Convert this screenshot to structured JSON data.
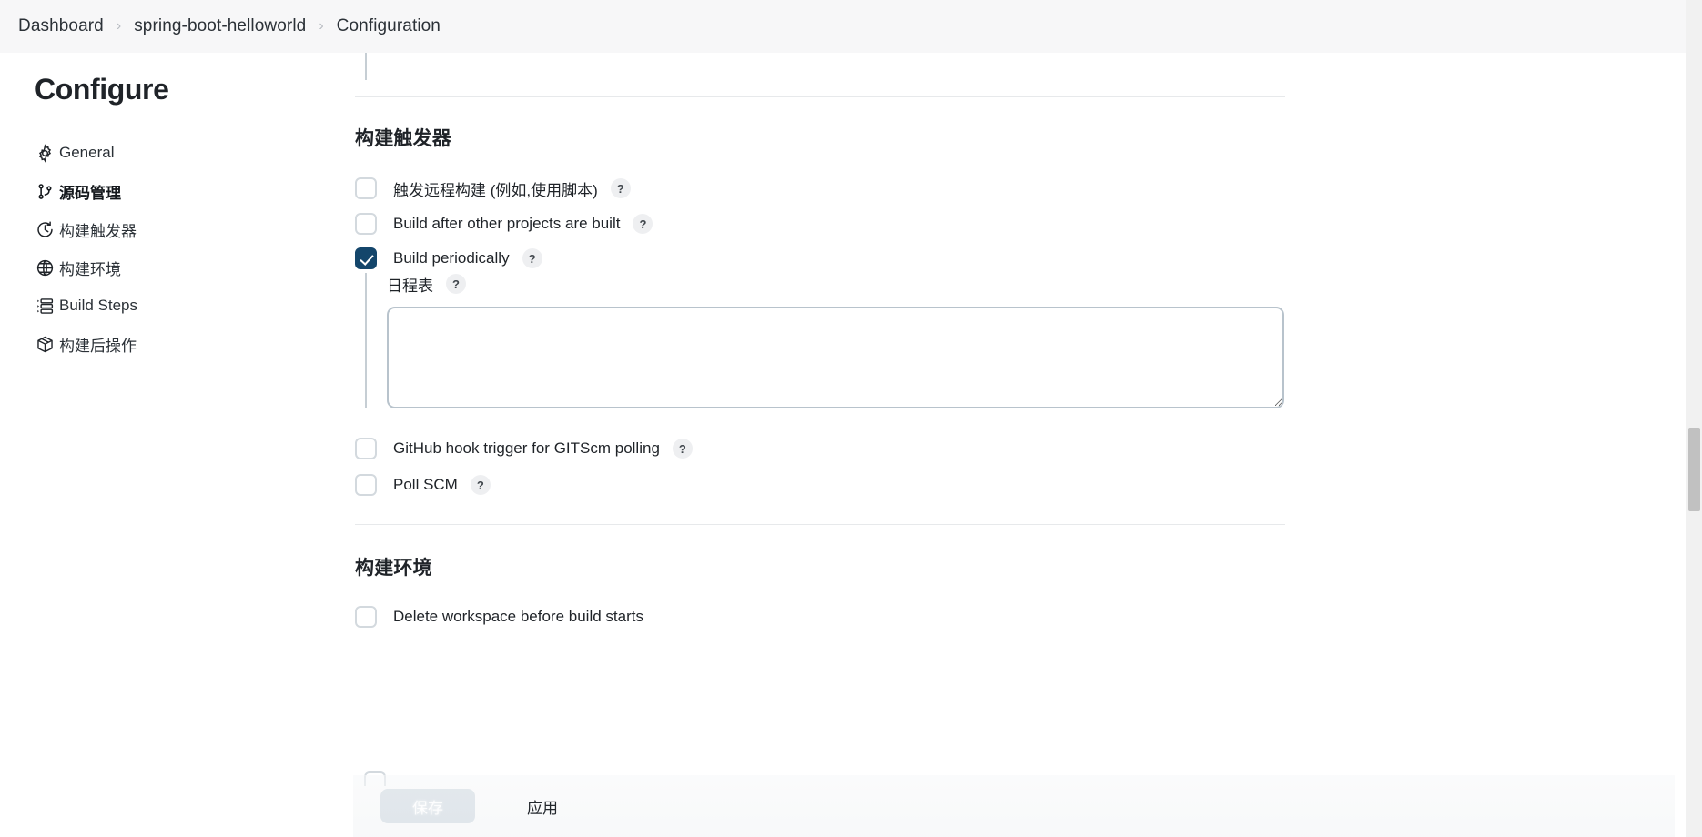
{
  "breadcrumb": {
    "items": [
      {
        "label": "Dashboard"
      },
      {
        "label": "spring-boot-helloworld"
      },
      {
        "label": "Configuration"
      }
    ],
    "separator": "›"
  },
  "sidebar": {
    "title": "Configure",
    "items": [
      {
        "label": "General",
        "icon": "gear-icon",
        "active": false
      },
      {
        "label": "源码管理",
        "icon": "git-branch-icon",
        "active": true
      },
      {
        "label": "构建触发器",
        "icon": "clock-icon",
        "active": false
      },
      {
        "label": "构建环境",
        "icon": "globe-icon",
        "active": false
      },
      {
        "label": "Build Steps",
        "icon": "list-steps-icon",
        "active": false
      },
      {
        "label": "构建后操作",
        "icon": "package-icon",
        "active": false
      }
    ]
  },
  "main": {
    "sections": {
      "triggers": {
        "title": "构建触发器",
        "checkboxes": {
          "remote": {
            "label": "触发远程构建 (例如,使用脚本)",
            "checked": false,
            "help": "?"
          },
          "after": {
            "label": "Build after other projects are built",
            "checked": false,
            "help": "?"
          },
          "periodically": {
            "label": "Build periodically",
            "checked": true,
            "help": "?"
          },
          "github": {
            "label": "GitHub hook trigger for GITScm polling",
            "checked": false,
            "help": "?"
          },
          "pollscm": {
            "label": "Poll SCM",
            "checked": false,
            "help": "?"
          }
        },
        "schedule": {
          "label": "日程表",
          "help": "?",
          "value": "",
          "placeholder": ""
        }
      },
      "environment": {
        "title": "构建环境",
        "checkboxes": {
          "delete_workspace": {
            "label": "Delete workspace before build starts",
            "checked": false
          }
        }
      }
    }
  },
  "footer": {
    "save_label": "保存",
    "apply_label": "应用"
  },
  "colors": {
    "accent": "#14466b",
    "breadcrumb_bg": "#f7f7f8",
    "border": "#e7e9eb",
    "input_border": "#b8c3cc",
    "checkbox_border": "#d3d9de",
    "indent_line": "#c6ced4",
    "scrollbar_thumb": "#c1c1c1"
  }
}
